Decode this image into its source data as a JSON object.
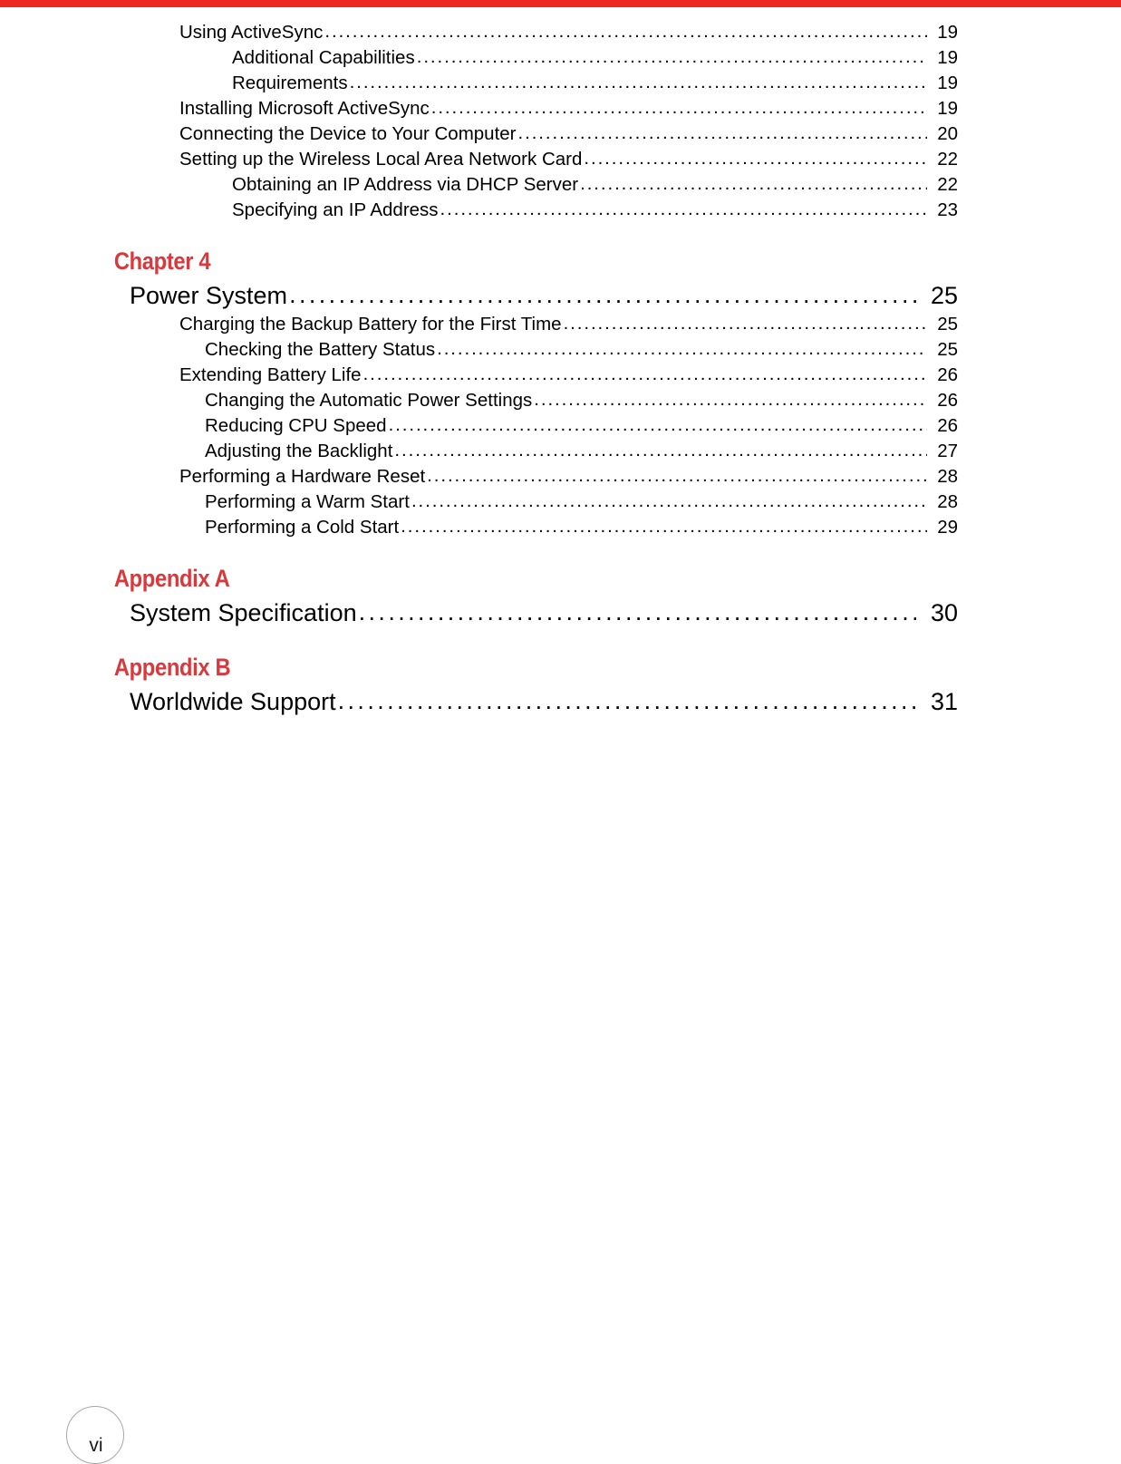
{
  "page": {
    "folio": "vi",
    "accent_color": "#d9383c",
    "rule_color": "#ee2722"
  },
  "toc": {
    "continued_entries": [
      {
        "level": 1,
        "title": "Using ActiveSync",
        "page": "19"
      },
      {
        "level": 2,
        "title": "Additional Capabilities",
        "page": "19"
      },
      {
        "level": 2,
        "title": "Requirements",
        "page": "19"
      },
      {
        "level": 1,
        "title": "Installing Microsoft ActiveSync",
        "page": "19"
      },
      {
        "level": 1,
        "title": "Connecting the Device to Your Computer",
        "page": "20"
      },
      {
        "level": 1,
        "title": "Setting up the Wireless Local Area Network Card",
        "page": "22"
      },
      {
        "level": 2,
        "title": "Obtaining an IP Address via DHCP Server",
        "page": "22"
      },
      {
        "level": 2,
        "title": "Specifying an IP Address",
        "page": "23"
      }
    ],
    "sections": [
      {
        "heading": "Chapter 4",
        "title": "Power System",
        "title_page": "25",
        "entries": [
          {
            "level": 1,
            "title": "Charging the Backup Battery for the First Time",
            "page": "25"
          },
          {
            "level": 2,
            "title": "Checking the Battery Status",
            "page": "25"
          },
          {
            "level": 1,
            "title": "Extending Battery Life",
            "page": "26"
          },
          {
            "level": 2,
            "title": "Changing the Automatic Power Settings",
            "page": "26"
          },
          {
            "level": 2,
            "title": "Reducing CPU Speed",
            "page": "26"
          },
          {
            "level": 2,
            "title": "Adjusting the Backlight",
            "page": "27"
          },
          {
            "level": 1,
            "title": "Performing a Hardware Reset",
            "page": "28"
          },
          {
            "level": 2,
            "title": "Performing a Warm Start",
            "page": "28"
          },
          {
            "level": 2,
            "title": "Performing a Cold Start",
            "page": "29"
          }
        ]
      },
      {
        "heading": "Appendix A",
        "title": "System Specification",
        "title_page": "30",
        "entries": []
      },
      {
        "heading": "Appendix B",
        "title": "Worldwide Support",
        "title_page": "31",
        "entries": []
      }
    ]
  }
}
